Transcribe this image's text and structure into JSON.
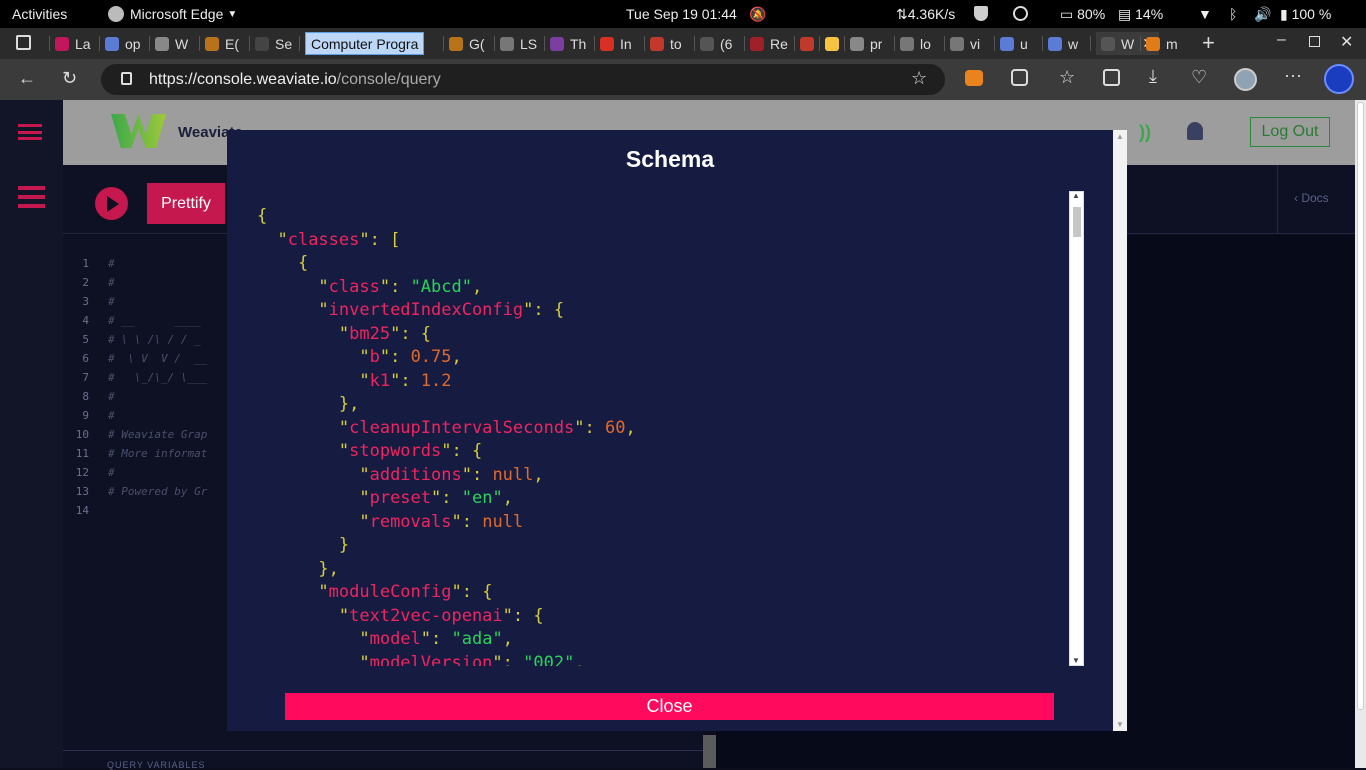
{
  "system_bar": {
    "activities": "Activities",
    "app_name": "Microsoft Edge",
    "clock": "Tue Sep 19  01:44",
    "net_speed": "⇅4.36K/s",
    "cpu": "80%",
    "mem": "14%",
    "battery": "100 %"
  },
  "tabs": [
    {
      "label": "La",
      "color": "#c2185b"
    },
    {
      "label": "op",
      "color": "#5b7bd5"
    },
    {
      "label": "W",
      "color": "#888888"
    },
    {
      "label": "E(",
      "color": "#b8731a"
    },
    {
      "label": "Se",
      "color": "#444444"
    },
    {
      "label": "Computer Progra",
      "color": "#bcd7f7"
    },
    {
      "label": "G(",
      "color": "#b8731a"
    },
    {
      "label": "LS",
      "color": "#777777"
    },
    {
      "label": "Th",
      "color": "#7b3fa0"
    },
    {
      "label": "In",
      "color": "#d93025"
    },
    {
      "label": "to",
      "color": "#c0392b"
    },
    {
      "label": "(6",
      "color": "#555555"
    },
    {
      "label": "Re",
      "color": "#a0202a"
    },
    {
      "label": "",
      "color": "#c0392b"
    },
    {
      "label": "",
      "color": "#f5c542"
    },
    {
      "label": "pr",
      "color": "#888888"
    },
    {
      "label": "lo",
      "color": "#777777"
    },
    {
      "label": "vi",
      "color": "#777777"
    },
    {
      "label": "u",
      "color": "#5b7bd5"
    },
    {
      "label": "w",
      "color": "#5b7bd5"
    },
    {
      "label": "W",
      "color": "#555555"
    },
    {
      "label": "m",
      "color": "#e07b1a"
    }
  ],
  "address_bar": {
    "url_host": "https://console.weaviate.io",
    "url_path": "/console/query"
  },
  "app": {
    "brand": "Weaviate",
    "prettify": "Prettify",
    "logout": "Log Out",
    "docs": "Docs",
    "query_variables": "QUERY VARIABLES",
    "editor_lines": [
      {
        "n": "1",
        "t": "#"
      },
      {
        "n": "2",
        "t": "#"
      },
      {
        "n": "3",
        "t": "#"
      },
      {
        "n": "4",
        "t": "# __      ____"
      },
      {
        "n": "5",
        "t": "# \\ \\ /\\ / / _"
      },
      {
        "n": "6",
        "t": "#  \\ V  V /  __"
      },
      {
        "n": "7",
        "t": "#   \\_/\\_/ \\___"
      },
      {
        "n": "8",
        "t": "#"
      },
      {
        "n": "9",
        "t": "#"
      },
      {
        "n": "10",
        "t": "# Weaviate Grap"
      },
      {
        "n": "11",
        "t": "# More informat"
      },
      {
        "n": "12",
        "t": "#"
      },
      {
        "n": "13",
        "t": "# Powered by Gr"
      },
      {
        "n": "14",
        "t": ""
      }
    ]
  },
  "modal": {
    "title": "Schema",
    "close": "Close",
    "code": [
      [
        [
          "p",
          "{"
        ]
      ],
      [
        [
          "p",
          "  \""
        ],
        [
          "k",
          "classes"
        ],
        [
          "p",
          "\": ["
        ]
      ],
      [
        [
          "p",
          "    {"
        ]
      ],
      [
        [
          "p",
          "      \""
        ],
        [
          "k",
          "class"
        ],
        [
          "p",
          "\": "
        ],
        [
          "s",
          "\"Abcd\""
        ],
        [
          "p",
          ","
        ]
      ],
      [
        [
          "p",
          "      \""
        ],
        [
          "k",
          "invertedIndexConfig"
        ],
        [
          "p",
          "\": {"
        ]
      ],
      [
        [
          "p",
          "        \""
        ],
        [
          "k",
          "bm25"
        ],
        [
          "p",
          "\": {"
        ]
      ],
      [
        [
          "p",
          "          \""
        ],
        [
          "k",
          "b"
        ],
        [
          "p",
          "\": "
        ],
        [
          "n",
          "0.75"
        ],
        [
          "p",
          ","
        ]
      ],
      [
        [
          "p",
          "          \""
        ],
        [
          "k",
          "k1"
        ],
        [
          "p",
          "\": "
        ],
        [
          "n",
          "1.2"
        ]
      ],
      [
        [
          "p",
          "        },"
        ]
      ],
      [
        [
          "p",
          "        \""
        ],
        [
          "k",
          "cleanupIntervalSeconds"
        ],
        [
          "p",
          "\": "
        ],
        [
          "n",
          "60"
        ],
        [
          "p",
          ","
        ]
      ],
      [
        [
          "p",
          "        \""
        ],
        [
          "k",
          "stopwords"
        ],
        [
          "p",
          "\": {"
        ]
      ],
      [
        [
          "p",
          "          \""
        ],
        [
          "k",
          "additions"
        ],
        [
          "p",
          "\": "
        ],
        [
          "n",
          "null"
        ],
        [
          "p",
          ","
        ]
      ],
      [
        [
          "p",
          "          \""
        ],
        [
          "k",
          "preset"
        ],
        [
          "p",
          "\": "
        ],
        [
          "s",
          "\"en\""
        ],
        [
          "p",
          ","
        ]
      ],
      [
        [
          "p",
          "          \""
        ],
        [
          "k",
          "removals"
        ],
        [
          "p",
          "\": "
        ],
        [
          "n",
          "null"
        ]
      ],
      [
        [
          "p",
          "        }"
        ]
      ],
      [
        [
          "p",
          "      },"
        ]
      ],
      [
        [
          "p",
          "      \""
        ],
        [
          "k",
          "moduleConfig"
        ],
        [
          "p",
          "\": {"
        ]
      ],
      [
        [
          "p",
          "        \""
        ],
        [
          "k",
          "text2vec-openai"
        ],
        [
          "p",
          "\": {"
        ]
      ],
      [
        [
          "p",
          "          \""
        ],
        [
          "k",
          "model"
        ],
        [
          "p",
          "\": "
        ],
        [
          "s",
          "\"ada\""
        ],
        [
          "p",
          ","
        ]
      ],
      [
        [
          "p",
          "          \""
        ],
        [
          "k",
          "modelVersion"
        ],
        [
          "p",
          "\": "
        ],
        [
          "s",
          "\"002\""
        ],
        [
          "p",
          ","
        ]
      ]
    ]
  },
  "colors": {
    "accent": "#ff0a5c",
    "modal_bg": "#161b42",
    "json_key": "#f0255f",
    "json_string": "#2bd35a",
    "json_number": "#e06a2a",
    "json_punct": "#d7ce38"
  }
}
